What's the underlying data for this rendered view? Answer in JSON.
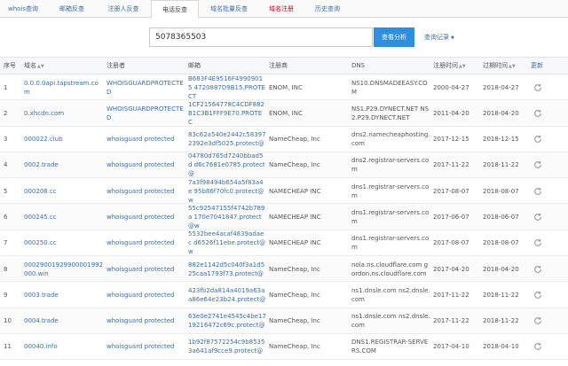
{
  "tabs": [
    {
      "label": "whois查询"
    },
    {
      "label": "邮箱反查"
    },
    {
      "label": "注册人反查"
    },
    {
      "label": "电话反查"
    },
    {
      "label": "域名批量反查"
    },
    {
      "label": "域名注册"
    },
    {
      "label": "历史查询"
    }
  ],
  "active_tab_label": "电话反查",
  "search": {
    "value": "5078365503",
    "button_label": "查看分析",
    "history_label": "查询记录"
  },
  "columns": [
    "序号",
    "域名",
    "注册者",
    "邮箱",
    "注册商",
    "DNS",
    "注册时间",
    "过期时间",
    "更新"
  ],
  "rows": [
    {
      "idx": "1",
      "domain": "0.0.0.0api.tapstream.com",
      "registrant": "WHOISGUARDPROTECTED",
      "email": "B683F4E9516F49909015 4720887D9B15.PROTECT",
      "registrar": "ENOM, INC",
      "dns": "NS10.DNSMADEEASY.COM",
      "created": "2000-04-27",
      "expires": "2018-04-27"
    },
    {
      "idx": "2",
      "domain": "0.xhcdn.com",
      "registrant": "WHOISGUARDPROTECTED",
      "email": "1CF21564778C4CDF882 B1C3B1FFF9E70.PROTEC",
      "registrar": "ENOM, INC",
      "dns": "NS1.P29.DYNECT.NET NS2.P29.DYNECT.NET",
      "created": "2011-04-20",
      "expires": "2018-04-20"
    },
    {
      "idx": "3",
      "domain": "000022.club",
      "registrant": "whoisguard protected",
      "email": "83c62a540e2442c58397 2392e3df5025.protect@",
      "registrar": "NameCheap, Inc",
      "dns": "dns2.namecheaphosting.com",
      "created": "2017-12-15",
      "expires": "2018-12-15"
    },
    {
      "idx": "4",
      "domain": "0002.trade",
      "registrant": "whoisguard protected",
      "email": "04780d765d7240bbad5d d6c7681e0785.protect@",
      "registrar": "NameCheap, Inc",
      "dns": "dns2.registrar-servers.com",
      "created": "2017-11-22",
      "expires": "2018-11-22"
    },
    {
      "idx": "5",
      "domain": "000208.cc",
      "registrant": "whoisguard protected",
      "email": "7a3f98494b654a5f83a4e 95b86f70fc0.protect@w",
      "registrar": "NAMECHEAP INC",
      "dns": "dns1.registrar-servers.com",
      "created": "2017-08-07",
      "expires": "2018-08-07"
    },
    {
      "idx": "6",
      "domain": "000245.cc",
      "registrant": "whoisguard protected",
      "email": "55c92547155f4742b789a 170e7041847.protect@w",
      "registrar": "NAMECHEAP INC",
      "dns": "dns1.registrar-servers.com",
      "created": "2017-06-07",
      "expires": "2018-06-07"
    },
    {
      "idx": "7",
      "domain": "000250.cc",
      "registrant": "whoisguard protected",
      "email": "5532bee4acaf4839adaec d6526f11ebe.protect@w",
      "registrar": "NAMECHEAP INC",
      "dns": "dns1.registrar-servers.com",
      "created": "2017-08-07",
      "expires": "2018-08-07"
    },
    {
      "idx": "8",
      "domain": "00029001929900001992 000.win",
      "registrant": "whoisguard protected",
      "email": "882e1142d5c040f3a1d5 25caa1793f73.protect@",
      "registrar": "NameCheap, Inc",
      "dns": "nola.ns.cloudflare.com gordon.ns.cloudflare.com",
      "created": "2017-04-20",
      "expires": "2018-04-20"
    },
    {
      "idx": "9",
      "domain": "0003.trade",
      "registrant": "whoisguard protected",
      "email": "423fb2da814a4019a63a a86e64e23b24.protect@",
      "registrar": "NameCheap, Inc",
      "dns": "ns1.dnsle.com ns2.dnsle.com",
      "created": "2017-11-22",
      "expires": "2018-11-22"
    },
    {
      "idx": "10",
      "domain": "0004.trade",
      "registrant": "whoisguard protected",
      "email": "63e0e2741e4545c4be17 19216472c69c.protect@",
      "registrar": "NameCheap, Inc",
      "dns": "ns1.dnsle.com ns2.dnsle.com",
      "created": "2017-11-22",
      "expires": "2018-11-22"
    },
    {
      "idx": "11",
      "domain": "00040.info",
      "registrant": "whoisguard protected",
      "email": "1b92f87572254c9b8535 3a641af9cce9.protect@",
      "registrar": "NameCheap, Inc",
      "dns": "DNS1.REGISTRAR-SERVERS.COM",
      "created": "2017-04-10",
      "expires": "2018-04-10"
    }
  ]
}
